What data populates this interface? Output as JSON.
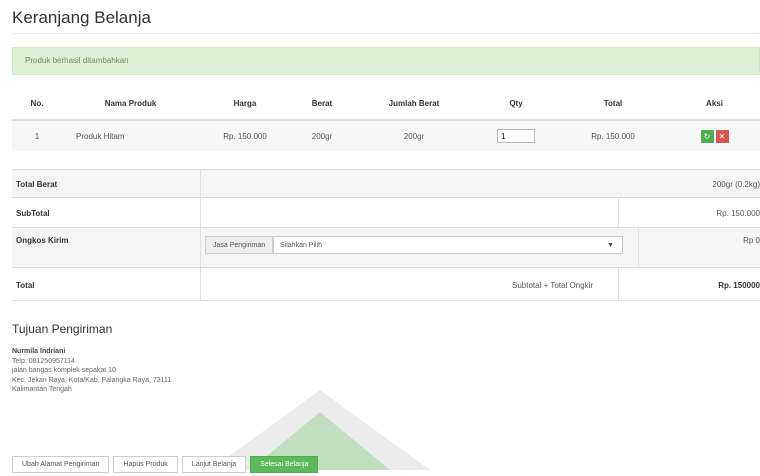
{
  "page": {
    "title": "Keranjang Belanja"
  },
  "alert": {
    "message": "Produk berhasil ditambahkan"
  },
  "cart_table": {
    "headers": [
      "No.",
      "Nama Produk",
      "Harga",
      "Berat",
      "Jumlah Berat",
      "Qty",
      "Total",
      "Aksi"
    ],
    "rows": [
      {
        "no": "1",
        "name": "Produk Hitam",
        "price": "Rp. 150.000",
        "weight": "200gr",
        "total_weight": "200gr",
        "qty": "1",
        "total": "Rp. 150.000"
      }
    ]
  },
  "summary": {
    "total_weight_label": "Total Berat",
    "total_weight_value": "200gr (0.2kg)",
    "subtotal_label": "SubTotal",
    "subtotal_value": "Rp. 150.000",
    "shipping_label": "Ongkos Kirim",
    "shipping_addon": "Jasa Pengiriman",
    "shipping_select": "Silahkan Pilih",
    "shipping_value": "Rp 0",
    "total_label": "Total",
    "total_formula": "Subtotal + Total Ongkir",
    "total_value": "Rp. 150000"
  },
  "shipping": {
    "section_title": "Tujuan Pengiriman",
    "recipient": "Nurmila Indriani",
    "phone": "Telp: 081250957114",
    "street": "jalan bangas komplek sepakat 10",
    "area": "Kec. Jekan Raya, Kota/Kab. Palangka Raya, 73111",
    "province": "Kalimantan Tengah"
  },
  "actions": {
    "change_address": "Ubah Alamat Pengiriman",
    "clear_products": "Hapus Produk",
    "continue_shopping": "Lanjut Belanja",
    "checkout": "Selesai Belanja"
  },
  "colors": {
    "success": "#5cb85c",
    "danger": "#d9534f",
    "alert_bg": "#dff0d8"
  }
}
